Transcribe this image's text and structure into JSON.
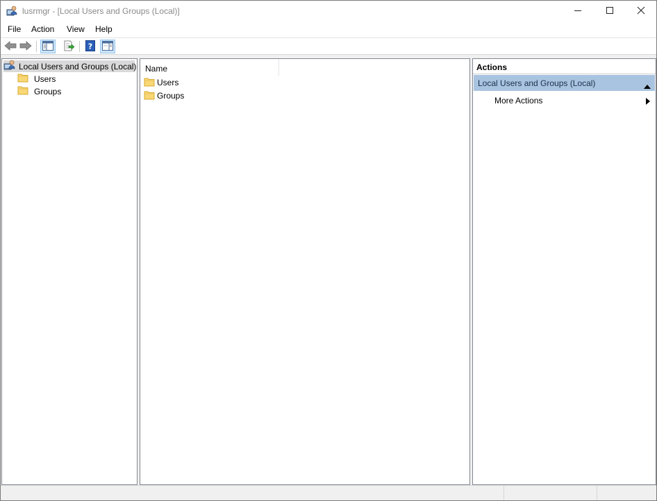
{
  "window": {
    "title": "lusrmgr - [Local Users and Groups (Local)]",
    "icon": "lusrmgr-app-icon",
    "controls": [
      "minimize-icon",
      "maximize-icon",
      "close-icon"
    ]
  },
  "menu": {
    "file": "File",
    "action": "Action",
    "view": "View",
    "help": "Help"
  },
  "toolbar": {
    "buttons": [
      "back-arrow-icon",
      "forward-arrow-icon",
      "show-hide-console-tree-icon",
      "export-list-icon",
      "help-icon",
      "show-hide-action-pane-icon"
    ]
  },
  "tree": {
    "root": "Local Users and Groups (Local)",
    "children": [
      "Users",
      "Groups"
    ]
  },
  "list": {
    "column_header": "Name",
    "items": [
      "Users",
      "Groups"
    ]
  },
  "actions": {
    "title": "Actions",
    "section": "Local Users and Groups (Local)",
    "items": [
      "More Actions"
    ]
  },
  "colors": {
    "selection_bg": "#d9d9d9",
    "actions_section_bg": "#a9c4e0",
    "folder_fill": "#f8d775",
    "folder_edge": "#d9a933"
  }
}
